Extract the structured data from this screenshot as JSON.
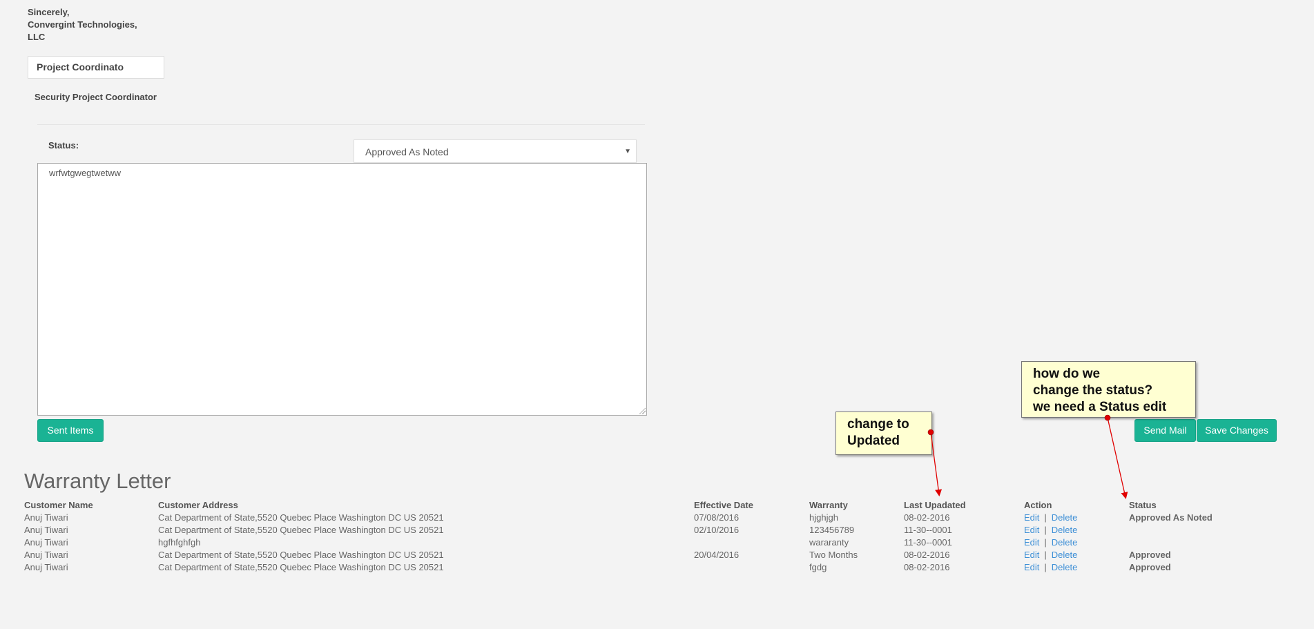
{
  "signature": {
    "closing": "Sincerely,",
    "company_line1": "Convergint Technologies,",
    "company_line2": "LLC"
  },
  "title_field": {
    "value": "Project Coordinato"
  },
  "sender_title": "Security Project Coordinator",
  "status": {
    "label": "Status:",
    "selected": "Approved As Noted"
  },
  "message_body": "wrfwtgwegtwetww",
  "buttons": {
    "sent_items": "Sent Items",
    "send_mail": "Send Mail",
    "save_changes": "Save Changes"
  },
  "annotations": {
    "note1": {
      "line1": "change to",
      "line2": "Updated"
    },
    "note2": {
      "line1": "how do we",
      "line2": "change the status?",
      "line3": "we need a Status edit"
    }
  },
  "warranty": {
    "title": "Warranty Letter",
    "columns": {
      "name": "Customer Name",
      "address": "Customer Address",
      "effective": "Effective Date",
      "warranty": "Warranty",
      "updated": "Last Upadated",
      "action": "Action",
      "status": "Status"
    },
    "action_labels": {
      "edit": "Edit",
      "sep": "|",
      "delete": "Delete"
    },
    "rows": [
      {
        "name": "Anuj Tiwari",
        "address": "Cat Department of State,5520 Quebec Place Washington DC US 20521",
        "effective": "07/08/2016",
        "warranty": "hjghjgh",
        "updated": "08-02-2016",
        "status": "Approved As Noted"
      },
      {
        "name": "Anuj Tiwari",
        "address": "Cat Department of State,5520 Quebec Place Washington DC US 20521",
        "effective": "02/10/2016",
        "warranty": "123456789",
        "updated": "11-30--0001",
        "status": ""
      },
      {
        "name": "Anuj Tiwari",
        "address": "hgfhfghfgh",
        "effective": "",
        "warranty": "wararanty",
        "updated": "11-30--0001",
        "status": ""
      },
      {
        "name": "Anuj Tiwari",
        "address": "Cat Department of State,5520 Quebec Place Washington DC US 20521",
        "effective": "20/04/2016",
        "warranty": "Two Months",
        "updated": "08-02-2016",
        "status": "Approved"
      },
      {
        "name": "Anuj Tiwari",
        "address": "Cat Department of State,5520 Quebec Place Washington DC US 20521",
        "effective": "",
        "warranty": "fgdg",
        "updated": "08-02-2016",
        "status": "Approved"
      }
    ]
  },
  "colors": {
    "page_bg": "#f3f3f3",
    "button_green": "#1ab394",
    "link_blue": "#3d8fd6",
    "callout_bg": "#ffffd2",
    "arrow_red": "#e00000"
  }
}
